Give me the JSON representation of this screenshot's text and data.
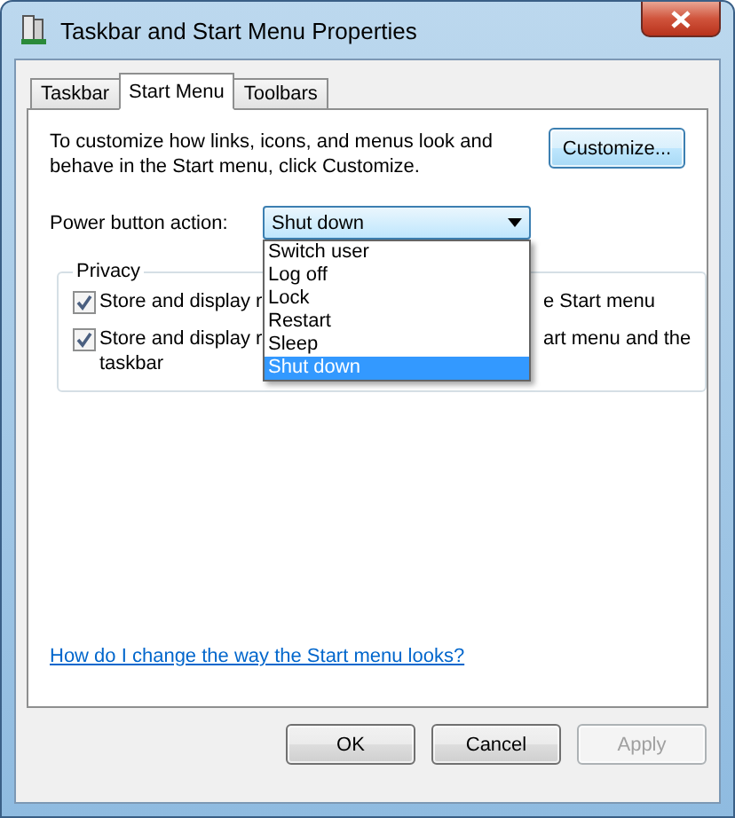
{
  "window": {
    "title": "Taskbar and Start Menu Properties"
  },
  "tabs": [
    {
      "label": "Taskbar",
      "selected": false
    },
    {
      "label": "Start Menu",
      "selected": true
    },
    {
      "label": "Toolbars",
      "selected": false
    }
  ],
  "description": "To customize how links, icons, and menus look and behave in the Start menu, click Customize.",
  "customize_button": {
    "label": "Customize..."
  },
  "power_button_action": {
    "label": "Power button action:",
    "value": "Shut down",
    "expanded": true,
    "options": [
      {
        "label": "Switch user",
        "selected": false
      },
      {
        "label": "Log off",
        "selected": false
      },
      {
        "label": "Lock",
        "selected": false
      },
      {
        "label": "Restart",
        "selected": false
      },
      {
        "label": "Sleep",
        "selected": false
      },
      {
        "label": "Shut down",
        "selected": true
      }
    ]
  },
  "privacy": {
    "title": "Privacy",
    "checkboxes": [
      {
        "visible_start": "Store and display r",
        "visible_end": "e Start menu",
        "checked": true
      },
      {
        "visible_start": "Store and display r",
        "visible_end": "art menu and the",
        "continuation": "taskbar",
        "checked": true
      }
    ]
  },
  "help_link": "How do I change the way the Start menu looks?",
  "buttons": [
    {
      "label": "OK",
      "disabled": false
    },
    {
      "label": "Cancel",
      "disabled": false
    },
    {
      "label": "Apply",
      "disabled": true
    }
  ]
}
